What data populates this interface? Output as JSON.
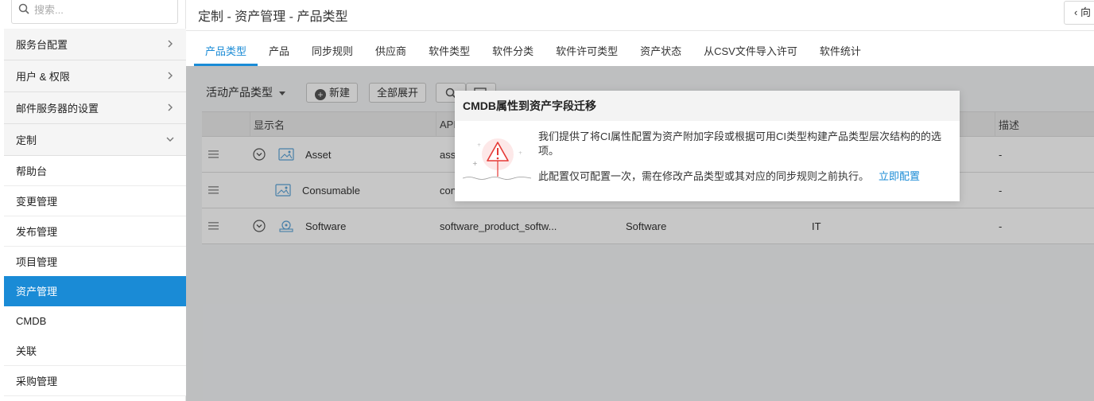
{
  "sidebar": {
    "search_placeholder": "搜索...",
    "sections": [
      {
        "label": "服务台配置"
      },
      {
        "label": "用户 & 权限"
      },
      {
        "label": "邮件服务器的设置"
      },
      {
        "label": "定制"
      }
    ],
    "sub_items": [
      {
        "label": "帮助台"
      },
      {
        "label": "变更管理"
      },
      {
        "label": "发布管理"
      },
      {
        "label": "项目管理"
      },
      {
        "label": "资产管理"
      },
      {
        "label": "CMDB"
      },
      {
        "label": "关联"
      },
      {
        "label": "采购管理"
      }
    ],
    "active_item": "资产管理"
  },
  "header": {
    "title": "定制 - 资产管理 - 产品类型",
    "right_button": "向"
  },
  "tabs": [
    {
      "label": "产品类型",
      "active": true
    },
    {
      "label": "产品"
    },
    {
      "label": "同步规则"
    },
    {
      "label": "供应商"
    },
    {
      "label": "软件类型"
    },
    {
      "label": "软件分类"
    },
    {
      "label": "软件许可类型"
    },
    {
      "label": "资产状态"
    },
    {
      "label": "从CSV文件导入许可"
    },
    {
      "label": "软件统计"
    }
  ],
  "toolbar": {
    "filter_label": "活动产品类型",
    "new_label": "新建",
    "expand_label": "全部展开"
  },
  "table": {
    "headers": {
      "name": "显示名",
      "api": "API",
      "desc": "描述"
    },
    "rows": [
      {
        "name": "Asset",
        "api": "ass",
        "type": "",
        "category": "",
        "desc": "-"
      },
      {
        "name": "Consumable",
        "api": "con",
        "type": "",
        "category": "",
        "desc": "-"
      },
      {
        "name": "Software",
        "api": "software_product_softw...",
        "type": "Software",
        "category": "IT",
        "desc": "-"
      }
    ]
  },
  "modal": {
    "title": "CMDB属性到资产字段迁移",
    "text1": "我们提供了将CI属性配置为资产附加字段或根据可用CI类型构建产品类型层次结构的的选项。",
    "text2": "此配置仅可配置一次，需在修改产品类型或其对应的同步规则之前执行。",
    "link": "立即配置"
  },
  "colors": {
    "accent": "#1a8bd6",
    "warning": "#e53935"
  }
}
